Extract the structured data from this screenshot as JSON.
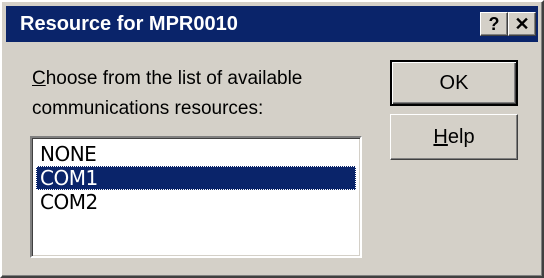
{
  "window": {
    "title": "Resource for MPR0010",
    "help_button": "?",
    "close_button": "✕"
  },
  "prompt": {
    "access_key": "C",
    "rest": "hoose from the list of available communications resources:"
  },
  "listbox": {
    "items": [
      "NONE",
      "COM1",
      "COM2"
    ],
    "selected": "COM1"
  },
  "buttons": {
    "ok": "OK",
    "help_access_key": "H",
    "help_rest": "elp"
  },
  "colors": {
    "titlebar": "#0a246a",
    "face": "#d4d0c8",
    "selection": "#0a246a"
  }
}
